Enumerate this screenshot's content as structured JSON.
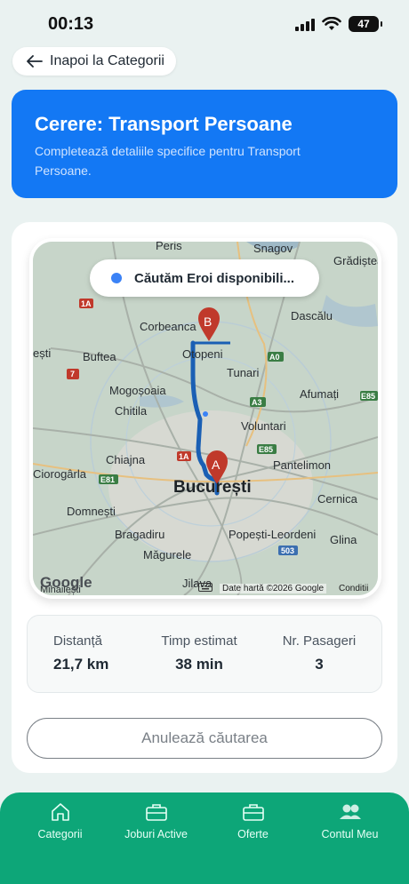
{
  "status_bar": {
    "time": "00:13",
    "battery": "47"
  },
  "back_button": {
    "label": "Inapoi la Categorii"
  },
  "header": {
    "title": "Cerere: Transport Persoane",
    "subtitle_line1": "Completează detaliile specifice pentru Transport",
    "subtitle_line2": "Persoane."
  },
  "map": {
    "search_status": "Căutăm Eroi disponibili...",
    "marker_a": "A",
    "marker_b": "B",
    "main_city": "București",
    "places": [
      "Peris",
      "Snagov",
      "Grădiștea",
      "Corbeanca",
      "Dascălu",
      "ești",
      "Buftea",
      "Otopeni",
      "Tunari",
      "Mogoșoaia",
      "Afumați",
      "Chitila",
      "Voluntari",
      "Chiajna",
      "Pantelimon",
      "Ciorogârla",
      "Domnești",
      "Cernica",
      "Bragadiru",
      "Popești-Leordeni",
      "Măgurele",
      "Glina",
      "Jilava",
      "Mihailești"
    ],
    "road_labels": [
      "1A",
      "A0",
      "A3",
      "E85",
      "E81",
      "E85",
      "503",
      "7"
    ],
    "google": "Google",
    "attribution": "Date hartă ©2026 Google",
    "conditions": "Conditii"
  },
  "stats": [
    {
      "label": "Distanță",
      "value": "21,7 km"
    },
    {
      "label": "Timp estimat",
      "value": "38 min"
    },
    {
      "label": "Nr. Pasageri",
      "value": "3"
    }
  ],
  "cancel_button": {
    "label": "Anulează căutarea"
  },
  "bottom_nav": [
    {
      "label": "Categorii",
      "icon": "home-icon"
    },
    {
      "label": "Joburi Active",
      "icon": "briefcase-icon"
    },
    {
      "label": "Oferte",
      "icon": "briefcase-icon"
    },
    {
      "label": "Contul Meu",
      "icon": "users-icon"
    }
  ],
  "colors": {
    "primary_blue": "#1378f4",
    "nav_green": "#0da678",
    "route_blue": "#1a5fb4",
    "marker_red": "#c0392b"
  }
}
